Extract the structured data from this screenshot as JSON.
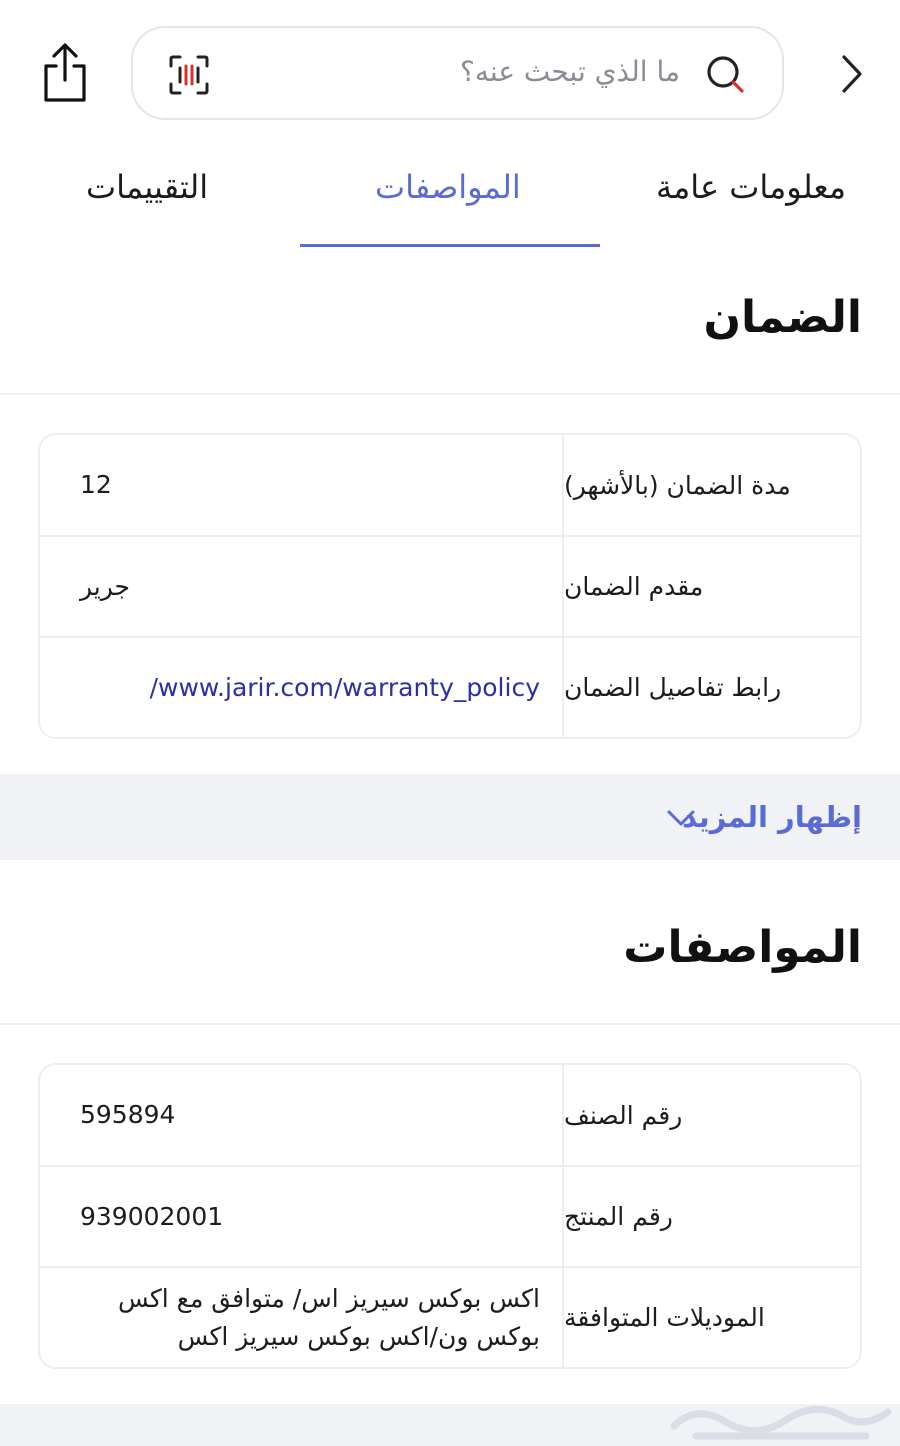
{
  "search": {
    "placeholder": "ما الذي تبحث عنه؟"
  },
  "tabs": [
    {
      "label": "معلومات عامة",
      "active": false
    },
    {
      "label": "المواصفات",
      "active": true
    },
    {
      "label": "التقييمات",
      "active": false
    }
  ],
  "warranty": {
    "title": "الضمان",
    "rows": [
      {
        "label": "مدة الضمان (بالأشهر)",
        "value": "12"
      },
      {
        "label": "مقدم الضمان",
        "value": "جرير"
      },
      {
        "label": "رابط تفاصيل الضمان",
        "value": "/www.jarir.com/warranty_policy"
      }
    ]
  },
  "show_more": {
    "label": "إظهار المزيد"
  },
  "specs": {
    "title": "المواصفات",
    "rows": [
      {
        "label": "رقم الصنف",
        "value": "595894"
      },
      {
        "label": "رقم المنتج",
        "value": "939002001"
      },
      {
        "label": "الموديلات المتوافقة",
        "value": "اكس بوكس سيريز اس/ متوافق مع اكس بوكس ون/اكس بوكس سيريز اكس"
      }
    ]
  },
  "colors": {
    "accent": "#5a6bd6",
    "link": "#2b2fa8",
    "band": "#f0f2f6",
    "border": "#eceef3"
  },
  "icons": {
    "share": "share-icon",
    "scan": "barcode-scan-icon",
    "search": "search-icon",
    "back": "chevron-right-icon",
    "more": "chevron-down-icon"
  }
}
